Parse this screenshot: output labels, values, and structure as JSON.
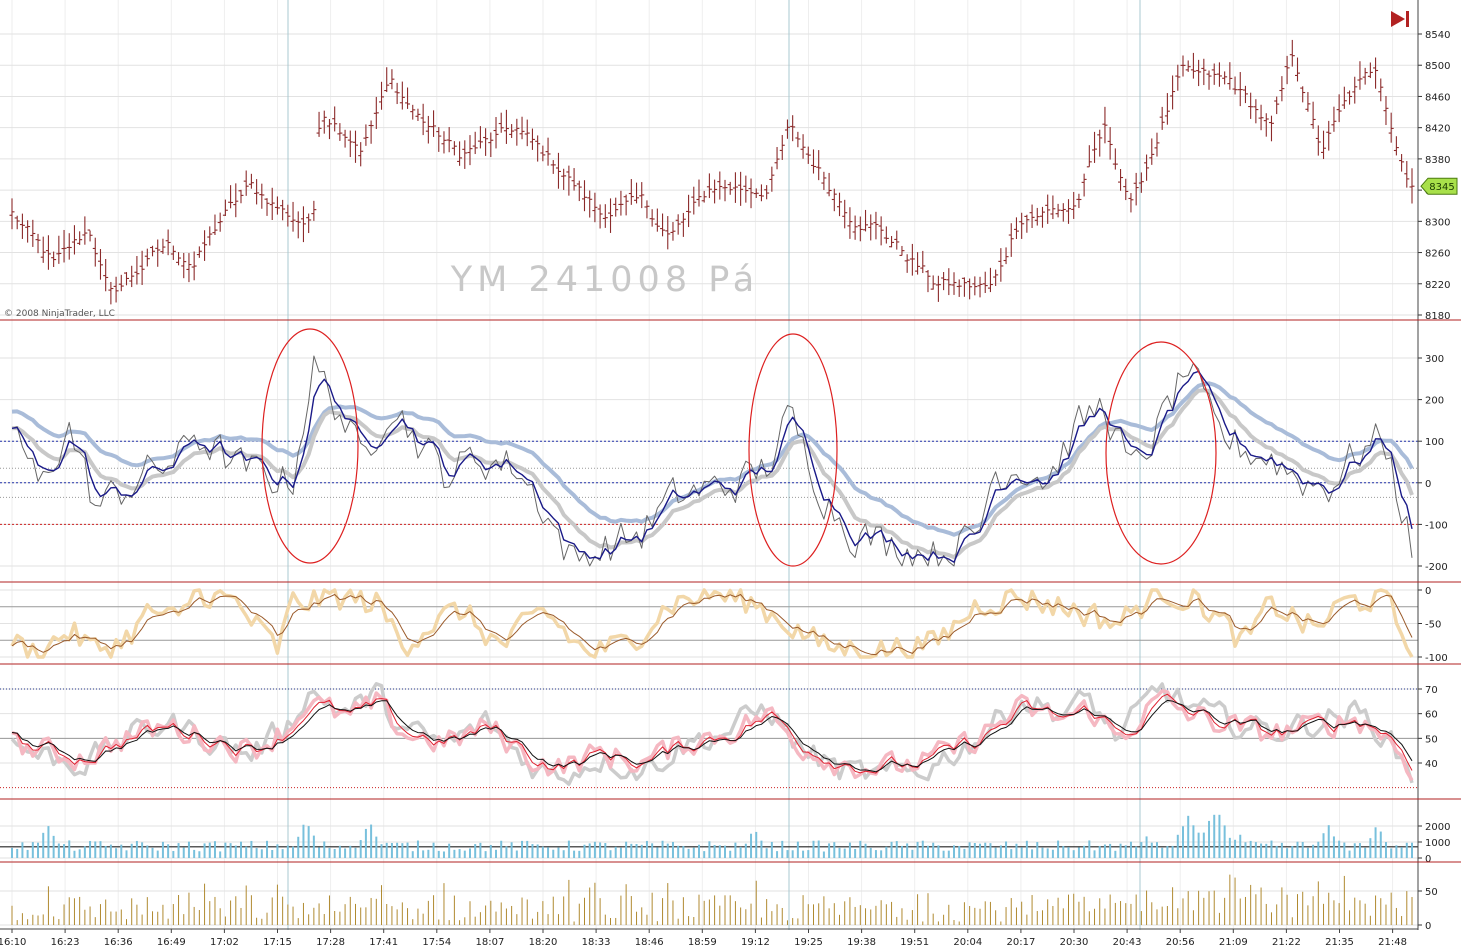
{
  "instrument_label": "YM 241008 Pá",
  "copyright": "© 2008 NinjaTrader, LLC",
  "price_marker": "8345",
  "colors": {
    "divider": "#b22222",
    "price_bar": "#8b2a2a",
    "marker_bg": "#a8e04a",
    "nav_icon": "#b22222"
  },
  "chart_data": [
    {
      "type": "bar",
      "name": "price",
      "ylim": [
        8180,
        8560
      ],
      "y_ticks": [
        8180,
        8220,
        8260,
        8300,
        8340,
        8380,
        8420,
        8460,
        8500,
        8540
      ],
      "last_price": 8345,
      "anchors": [
        [
          0,
          8310
        ],
        [
          0.03,
          8245
        ],
        [
          0.055,
          8290
        ],
        [
          0.07,
          8205
        ],
        [
          0.11,
          8270
        ],
        [
          0.13,
          8245
        ],
        [
          0.15,
          8305
        ],
        [
          0.17,
          8345
        ],
        [
          0.2,
          8305
        ],
        [
          0.215,
          8295
        ],
        [
          0.22,
          8445
        ],
        [
          0.25,
          8395
        ],
        [
          0.27,
          8480
        ],
        [
          0.29,
          8435
        ],
        [
          0.32,
          8385
        ],
        [
          0.36,
          8420
        ],
        [
          0.39,
          8370
        ],
        [
          0.42,
          8310
        ],
        [
          0.45,
          8325
        ],
        [
          0.47,
          8280
        ],
        [
          0.5,
          8345
        ],
        [
          0.54,
          8340
        ],
        [
          0.555,
          8420
        ],
        [
          0.6,
          8305
        ],
        [
          0.62,
          8290
        ],
        [
          0.66,
          8220
        ],
        [
          0.7,
          8215
        ],
        [
          0.72,
          8305
        ],
        [
          0.76,
          8320
        ],
        [
          0.78,
          8420
        ],
        [
          0.8,
          8320
        ],
        [
          0.835,
          8490
        ],
        [
          0.87,
          8480
        ],
        [
          0.9,
          8420
        ],
        [
          0.915,
          8515
        ],
        [
          0.935,
          8390
        ],
        [
          0.955,
          8460
        ],
        [
          0.975,
          8500
        ],
        [
          0.99,
          8390
        ],
        [
          1,
          8345
        ]
      ]
    },
    {
      "type": "line",
      "name": "cci",
      "ylim": [
        -220,
        360
      ],
      "y_ticks": [
        -200,
        -100,
        0,
        100,
        200,
        300
      ],
      "levels": [
        100,
        0,
        -100
      ],
      "anchors": [
        [
          0,
          150
        ],
        [
          0.02,
          -20
        ],
        [
          0.04,
          140
        ],
        [
          0.06,
          -60
        ],
        [
          0.1,
          30
        ],
        [
          0.12,
          60
        ],
        [
          0.13,
          120
        ],
        [
          0.16,
          40
        ],
        [
          0.2,
          0
        ],
        [
          0.215,
          280
        ],
        [
          0.235,
          170
        ],
        [
          0.25,
          50
        ],
        [
          0.27,
          200
        ],
        [
          0.29,
          100
        ],
        [
          0.31,
          20
        ],
        [
          0.33,
          60
        ],
        [
          0.36,
          40
        ],
        [
          0.38,
          -60
        ],
        [
          0.4,
          -190
        ],
        [
          0.42,
          -160
        ],
        [
          0.45,
          -120
        ],
        [
          0.47,
          -40
        ],
        [
          0.49,
          -20
        ],
        [
          0.52,
          0
        ],
        [
          0.54,
          40
        ],
        [
          0.555,
          160
        ],
        [
          0.58,
          -30
        ],
        [
          0.6,
          -120
        ],
        [
          0.63,
          -150
        ],
        [
          0.66,
          -170
        ],
        [
          0.69,
          -130
        ],
        [
          0.7,
          20
        ],
        [
          0.72,
          40
        ],
        [
          0.74,
          10
        ],
        [
          0.76,
          130
        ],
        [
          0.78,
          190
        ],
        [
          0.8,
          20
        ],
        [
          0.82,
          140
        ],
        [
          0.84,
          280
        ],
        [
          0.86,
          120
        ],
        [
          0.88,
          80
        ],
        [
          0.9,
          60
        ],
        [
          0.92,
          10
        ],
        [
          0.94,
          -10
        ],
        [
          0.96,
          70
        ],
        [
          0.98,
          110
        ],
        [
          1,
          -160
        ]
      ]
    },
    {
      "type": "line",
      "name": "williams",
      "ylim": [
        -105,
        5
      ],
      "y_ticks": [
        0,
        -50,
        -100
      ],
      "levels": [
        -25,
        -75
      ],
      "anchors": [
        [
          0,
          -80
        ],
        [
          0.02,
          -95
        ],
        [
          0.04,
          -60
        ],
        [
          0.06,
          -90
        ],
        [
          0.08,
          -75
        ],
        [
          0.1,
          -30
        ],
        [
          0.12,
          -50
        ],
        [
          0.13,
          0
        ],
        [
          0.16,
          -20
        ],
        [
          0.19,
          -90
        ],
        [
          0.2,
          -20
        ],
        [
          0.23,
          -10
        ],
        [
          0.26,
          -20
        ],
        [
          0.28,
          -80
        ],
        [
          0.3,
          -50
        ],
        [
          0.32,
          -30
        ],
        [
          0.35,
          -85
        ],
        [
          0.38,
          -30
        ],
        [
          0.41,
          -95
        ],
        [
          0.44,
          -80
        ],
        [
          0.47,
          -20
        ],
        [
          0.5,
          -5
        ],
        [
          0.53,
          -20
        ],
        [
          0.55,
          -45
        ],
        [
          0.58,
          -85
        ],
        [
          0.62,
          -90
        ],
        [
          0.66,
          -80
        ],
        [
          0.69,
          -20
        ],
        [
          0.72,
          -10
        ],
        [
          0.76,
          -30
        ],
        [
          0.79,
          -50
        ],
        [
          0.82,
          0
        ],
        [
          0.85,
          -20
        ],
        [
          0.88,
          -80
        ],
        [
          0.9,
          -20
        ],
        [
          0.93,
          -60
        ],
        [
          0.95,
          -20
        ],
        [
          0.98,
          -10
        ],
        [
          1,
          -95
        ]
      ]
    },
    {
      "type": "line",
      "name": "rsi",
      "ylim": [
        27,
        76
      ],
      "y_ticks": [
        40,
        50,
        60,
        70
      ],
      "levels": [
        70,
        50,
        30
      ],
      "anchors": [
        [
          0,
          48
        ],
        [
          0.02,
          45
        ],
        [
          0.05,
          42
        ],
        [
          0.08,
          50
        ],
        [
          0.11,
          55
        ],
        [
          0.14,
          50
        ],
        [
          0.17,
          45
        ],
        [
          0.2,
          55
        ],
        [
          0.21,
          65
        ],
        [
          0.24,
          58
        ],
        [
          0.26,
          64
        ],
        [
          0.28,
          52
        ],
        [
          0.31,
          48
        ],
        [
          0.34,
          55
        ],
        [
          0.37,
          42
        ],
        [
          0.39,
          38
        ],
        [
          0.42,
          44
        ],
        [
          0.45,
          40
        ],
        [
          0.48,
          48
        ],
        [
          0.51,
          52
        ],
        [
          0.54,
          60
        ],
        [
          0.56,
          48
        ],
        [
          0.59,
          40
        ],
        [
          0.62,
          38
        ],
        [
          0.65,
          40
        ],
        [
          0.69,
          50
        ],
        [
          0.72,
          62
        ],
        [
          0.75,
          58
        ],
        [
          0.77,
          62
        ],
        [
          0.79,
          50
        ],
        [
          0.82,
          66
        ],
        [
          0.84,
          60
        ],
        [
          0.87,
          55
        ],
        [
          0.9,
          52
        ],
        [
          0.93,
          55
        ],
        [
          0.96,
          58
        ],
        [
          0.98,
          52
        ],
        [
          1,
          38
        ]
      ]
    },
    {
      "type": "bar",
      "name": "volume",
      "ylim": [
        0,
        2700
      ],
      "y_ticks": [
        0,
        1000,
        2000
      ],
      "level": 700,
      "spikes": [
        [
          0.025,
          2000
        ],
        [
          0.21,
          2300
        ],
        [
          0.255,
          2200
        ],
        [
          0.53,
          1700
        ],
        [
          0.81,
          1300
        ],
        [
          0.84,
          2000
        ],
        [
          0.86,
          2900
        ],
        [
          0.94,
          2000
        ],
        [
          0.975,
          1900
        ]
      ]
    },
    {
      "type": "bar",
      "name": "trade_count",
      "ylim": [
        0,
        80
      ],
      "y_ticks": [
        0,
        50
      ]
    }
  ],
  "x_tick_labels": [
    "16:10",
    "16:23",
    "16:36",
    "16:49",
    "17:02",
    "17:15",
    "17:28",
    "17:41",
    "17:54",
    "18:07",
    "18:20",
    "18:33",
    "18:46",
    "18:59",
    "19:12",
    "19:25",
    "19:38",
    "19:51",
    "20:04",
    "20:17",
    "20:30",
    "20:43",
    "20:56",
    "21:09",
    "21:22",
    "21:35",
    "21:48"
  ]
}
